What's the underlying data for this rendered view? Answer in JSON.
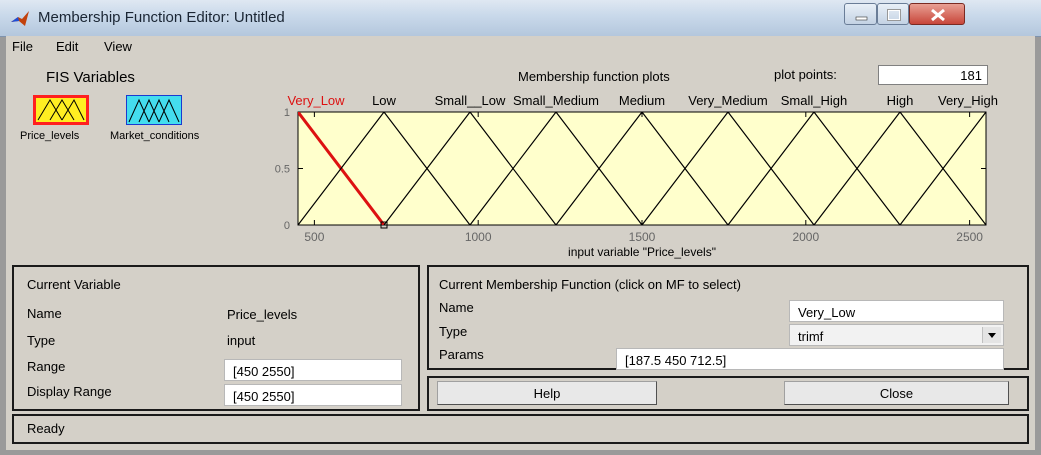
{
  "window": {
    "title": "Membership Function Editor: Untitled"
  },
  "menu": [
    "File",
    "Edit",
    "View"
  ],
  "fis_variables": {
    "label": "FIS Variables",
    "inputs": [
      {
        "name": "Price_levels",
        "display": "Price_levels",
        "selected": true,
        "color": "#ffee22"
      },
      {
        "name": "Market_conditions",
        "display": "Market_conditions",
        "selected": false,
        "color": "#44ddee"
      }
    ]
  },
  "plot": {
    "title": "Membership function plots",
    "plot_points_label": "plot points:",
    "plot_points": "181",
    "xlabel": "input variable \"Price_levels\"",
    "xlim": [
      450,
      2550
    ],
    "ylim": [
      0,
      1
    ],
    "xticks": [
      500,
      1000,
      1500,
      2000,
      2500
    ],
    "yticks": [
      0,
      0.5,
      1
    ],
    "ytick_labels": [
      "0",
      "0.5",
      "1"
    ],
    "background": "#ffffcc",
    "line_color": "#000000",
    "selected_color": "#dd1111",
    "mf_labels": [
      "Very_Low",
      "Low",
      "Small__Low",
      "Small_Medium",
      "Medium",
      "Very_Medium",
      "Small_High",
      "High",
      "Very_High"
    ]
  },
  "chart_data": {
    "type": "line",
    "title": "",
    "xlabel": "input variable \"Price_levels\"",
    "ylabel": "",
    "xlim": [
      450,
      2550
    ],
    "ylim": [
      0,
      1
    ],
    "series": [
      {
        "name": "Very_Low",
        "x": [
          187.5,
          450,
          712.5
        ],
        "y": [
          0,
          1,
          0
        ]
      },
      {
        "name": "Low",
        "x": [
          450,
          712.5,
          975
        ],
        "y": [
          0,
          1,
          0
        ]
      },
      {
        "name": "Small__Low",
        "x": [
          712.5,
          975,
          1237.5
        ],
        "y": [
          0,
          1,
          0
        ]
      },
      {
        "name": "Small_Medium",
        "x": [
          975,
          1237.5,
          1500
        ],
        "y": [
          0,
          1,
          0
        ]
      },
      {
        "name": "Medium",
        "x": [
          1237.5,
          1500,
          1762.5
        ],
        "y": [
          0,
          1,
          0
        ]
      },
      {
        "name": "Very_Medium",
        "x": [
          1500,
          1762.5,
          2025
        ],
        "y": [
          0,
          1,
          0
        ]
      },
      {
        "name": "Small_High",
        "x": [
          1762.5,
          2025,
          2287.5
        ],
        "y": [
          0,
          1,
          0
        ]
      },
      {
        "name": "High",
        "x": [
          2025,
          2287.5,
          2550
        ],
        "y": [
          0,
          1,
          0
        ]
      },
      {
        "name": "Very_High",
        "x": [
          2287.5,
          2550,
          2812.5
        ],
        "y": [
          0,
          1,
          0
        ]
      }
    ]
  },
  "current_variable": {
    "header": "Current Variable",
    "name_label": "Name",
    "name_value": "Price_levels",
    "type_label": "Type",
    "type_value": "input",
    "range_label": "Range",
    "range_value": "[450 2550]",
    "display_range_label": "Display Range",
    "display_range_value": "[450 2550]"
  },
  "current_mf": {
    "header": "Current Membership Function (click on MF to select)",
    "name_label": "Name",
    "name_value": "Very_Low",
    "type_label": "Type",
    "type_value": "trimf",
    "params_label": "Params",
    "params_value": "[187.5 450 712.5]"
  },
  "buttons": {
    "help": "Help",
    "close": "Close"
  },
  "status": "Ready"
}
